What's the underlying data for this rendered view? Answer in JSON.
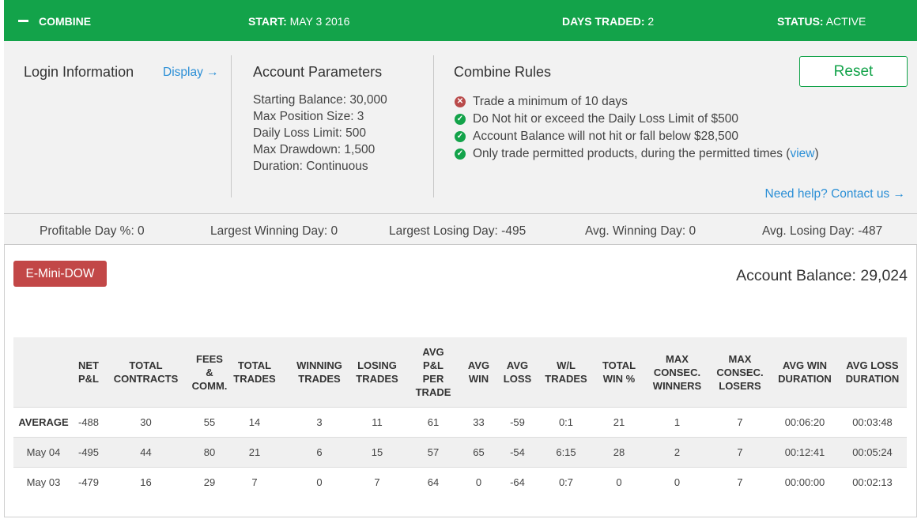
{
  "header": {
    "title": "COMBINE",
    "start_label": "START:",
    "start_value": "MAY 3 2016",
    "days_label": "DAYS TRADED:",
    "days_value": "2",
    "status_label": "STATUS:",
    "status_value": "ACTIVE"
  },
  "login": {
    "title": "Login Information",
    "display_link": "Display →"
  },
  "account_params": {
    "title": "Account Parameters",
    "items": [
      "Starting Balance: 30,000",
      "Max Position Size: 3",
      "Daily Loss Limit: 500",
      "Max Drawdown: 1,500",
      "Duration: Continuous"
    ]
  },
  "combine_rules": {
    "title": "Combine Rules",
    "rules": [
      {
        "text": "Trade a minimum of 10 days",
        "status": "fail"
      },
      {
        "text": "Do Not hit or exceed the Daily Loss Limit of $500",
        "status": "pass"
      },
      {
        "text": "Account Balance will not hit or fall below $28,500",
        "status": "pass"
      },
      {
        "text": "Only trade permitted products, during the permitted times (",
        "status": "pass",
        "link": "view",
        "suffix": ")"
      }
    ],
    "reset_label": "Reset",
    "help_link": "Need help? Contact us →"
  },
  "stats": {
    "profitable_day": "Profitable Day %: 0",
    "largest_winning": "Largest Winning Day: 0",
    "largest_losing": "Largest Losing Day: -495",
    "avg_winning": "Avg. Winning Day: 0",
    "avg_losing": "Avg. Losing Day: -487"
  },
  "product_button": "E-Mini-DOW",
  "account_balance": "Account Balance: 29,024",
  "table": {
    "columns": [
      "",
      "NET\nP&L",
      "TOTAL\nCONTRACTS",
      "FEES\n&\nCOMM.",
      "TOTAL\nTRADES",
      "WINNING\nTRADES",
      "LOSING\nTRADES",
      "AVG\nP&L\nPER\nTRADE",
      "AVG\nWIN",
      "AVG\nLOSS",
      "W/L\nTRADES",
      "TOTAL\nWIN %",
      "MAX\nCONSEC.\nWINNERS",
      "MAX\nCONSEC.\nLOSERS",
      "AVG WIN\nDURATION",
      "AVG LOSS\nDURATION"
    ],
    "rows": [
      {
        "label": "AVERAGE",
        "cells": [
          "-488",
          "30",
          "55",
          "14",
          "3",
          "11",
          "61",
          "33",
          "-59",
          "0:1",
          "21",
          "1",
          "7",
          "00:06:20",
          "00:03:48"
        ]
      },
      {
        "label": "May 04",
        "cells": [
          "-495",
          "44",
          "80",
          "21",
          "6",
          "15",
          "57",
          "65",
          "-54",
          "6:15",
          "28",
          "2",
          "7",
          "00:12:41",
          "00:05:24"
        ]
      },
      {
        "label": "May 03",
        "cells": [
          "-479",
          "16",
          "29",
          "7",
          "0",
          "7",
          "64",
          "0",
          "-64",
          "0:7",
          "0",
          "0",
          "7",
          "00:00:00",
          "00:02:13"
        ]
      }
    ]
  }
}
